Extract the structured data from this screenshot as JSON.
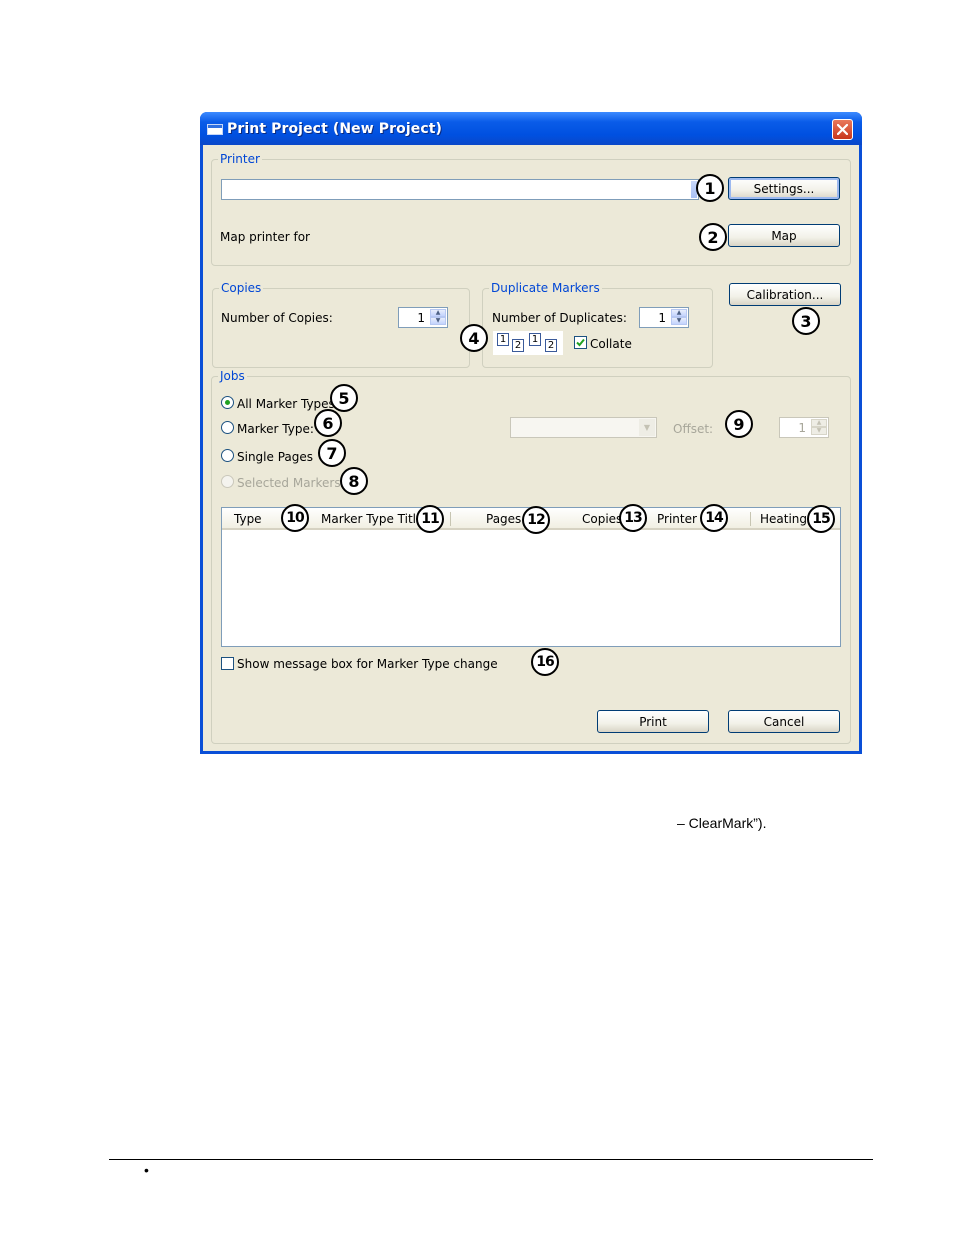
{
  "window": {
    "title": "Print Project (New Project)"
  },
  "printer_group": {
    "label": "Printer",
    "printer_select_value": "",
    "settings_button": "Settings...",
    "map_label": "Map printer for",
    "map_button": "Map"
  },
  "copies_group": {
    "label": "Copies",
    "number_label": "Number of Copies:",
    "value": "1"
  },
  "duplicate_group": {
    "label": "Duplicate Markers",
    "number_label": "Number of Duplicates:",
    "value": "1",
    "collate_label": "Collate",
    "collate_checked": true,
    "collate_digits": [
      "1",
      "2",
      "1",
      "2"
    ]
  },
  "calibration_button": "Calibration...",
  "jobs_group": {
    "label": "Jobs",
    "options": [
      {
        "label": "All Marker Types",
        "selected": true,
        "enabled": true
      },
      {
        "label": "Marker Type:",
        "selected": false,
        "enabled": true
      },
      {
        "label": "Single Pages",
        "selected": false,
        "enabled": true
      },
      {
        "label": "Selected Markers",
        "selected": false,
        "enabled": false
      }
    ],
    "marker_type_select_value": "",
    "offset_label": "Offset:",
    "offset_value": "1",
    "table_columns": [
      "Type",
      "Marker Type Title",
      "Pages",
      "Copies",
      "Printer",
      "Heating"
    ],
    "table_rows": []
  },
  "show_message_label": "Show message box for Marker Type change",
  "print_button": "Print",
  "cancel_button": "Cancel",
  "callouts": [
    "1",
    "2",
    "3",
    "4",
    "5",
    "6",
    "7",
    "8",
    "9",
    "10",
    "11",
    "12",
    "13",
    "14",
    "15",
    "16"
  ],
  "body_text": "– ClearMark”).",
  "footer_bullet": "•",
  "colors": {
    "titlebar": "#0a5ce8",
    "dialog_bg": "#ece9d8",
    "group_label": "#0046d5",
    "close_button": "#d5472a"
  }
}
